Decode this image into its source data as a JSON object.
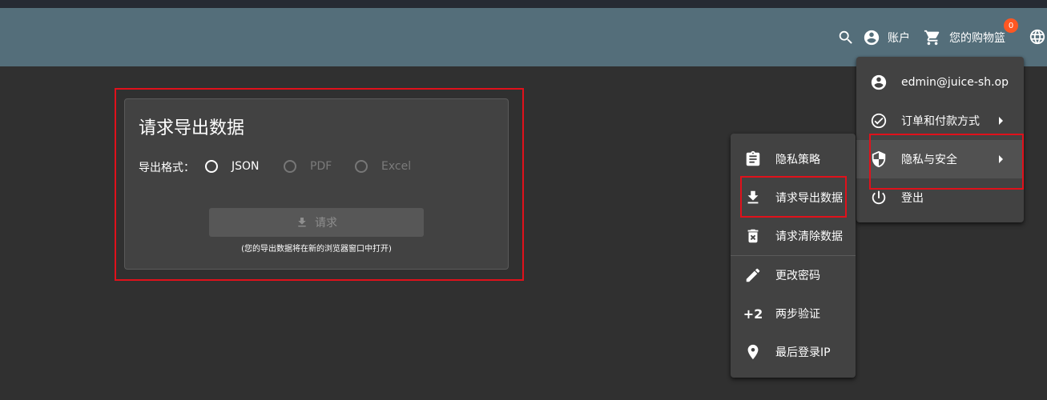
{
  "header": {
    "account_label": "账户",
    "basket_label": "您的购物篮",
    "basket_count": "0"
  },
  "account_menu": {
    "items": [
      {
        "label": "edmin@juice-sh.op",
        "icon": "account-circle-icon"
      },
      {
        "label": "订单和付款方式",
        "icon": "check-circle-icon"
      },
      {
        "label": "隐私与安全",
        "icon": "shield-icon"
      },
      {
        "label": "登出",
        "icon": "power-icon"
      }
    ]
  },
  "privacy_menu": {
    "items": [
      {
        "label": "隐私策略",
        "icon": "clipboard-icon"
      },
      {
        "label": "请求导出数据",
        "icon": "download-icon"
      },
      {
        "label": "请求清除数据",
        "icon": "delete-icon"
      },
      {
        "label": "更改密码",
        "icon": "pencil-icon"
      },
      {
        "label": "两步验证",
        "icon": "two-factor-icon",
        "glyph": "+2"
      },
      {
        "label": "最后登录IP",
        "icon": "location-icon"
      }
    ]
  },
  "export_card": {
    "title": "请求导出数据",
    "format_label": "导出格式：",
    "formats": [
      {
        "label": "JSON",
        "enabled": true
      },
      {
        "label": "PDF",
        "enabled": false
      },
      {
        "label": "Excel",
        "enabled": false
      }
    ],
    "request_button_label": "请求",
    "note": "(您的导出数据将在新的浏览器窗口中打开)"
  },
  "colors": {
    "navbar": "#546e7a",
    "background": "#303030",
    "menu": "#424242",
    "highlight_box": "#e0111b",
    "badge": "#ff5722"
  }
}
